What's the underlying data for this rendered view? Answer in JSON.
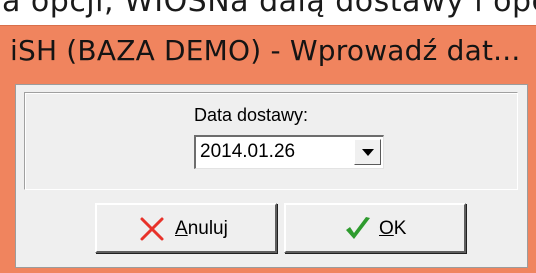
{
  "topstrip": {
    "partial_text": "a opcji, WIOSNa daią dostawy i opcją"
  },
  "window": {
    "title": "iSH (BAZA DEMO) - Wprowadź dat...",
    "accent_color": "#f0845e"
  },
  "form": {
    "date_label": "Data dostawy:",
    "date_value": "2014.01.26",
    "dropdown_icon": "chevron-down-icon"
  },
  "buttons": {
    "cancel": {
      "mnemonic": "A",
      "rest": "nuluj",
      "icon": "close-icon",
      "icon_color": "#e8322a"
    },
    "ok": {
      "mnemonic": "O",
      "rest": "K",
      "icon": "checkmark-icon",
      "icon_color": "#2e9b2e"
    }
  }
}
